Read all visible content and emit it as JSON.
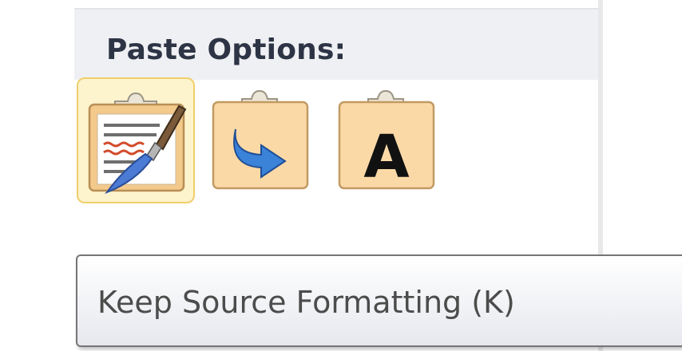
{
  "paste_menu": {
    "header": "Paste Options:",
    "options": [
      {
        "icon": "keep-source-formatting-icon",
        "selected": true
      },
      {
        "icon": "merge-formatting-icon",
        "selected": false
      },
      {
        "icon": "keep-text-only-icon",
        "selected": false,
        "glyph": "A"
      }
    ]
  },
  "tooltip": {
    "text": "Keep Source Formatting (K)"
  },
  "colors": {
    "header_bg": "#eff0f3",
    "selected_bg": "#fdf3cd",
    "selected_border": "#f0cf6a",
    "clipboard_fill": "#fbd9a6",
    "clipboard_border": "#c8a46e"
  }
}
